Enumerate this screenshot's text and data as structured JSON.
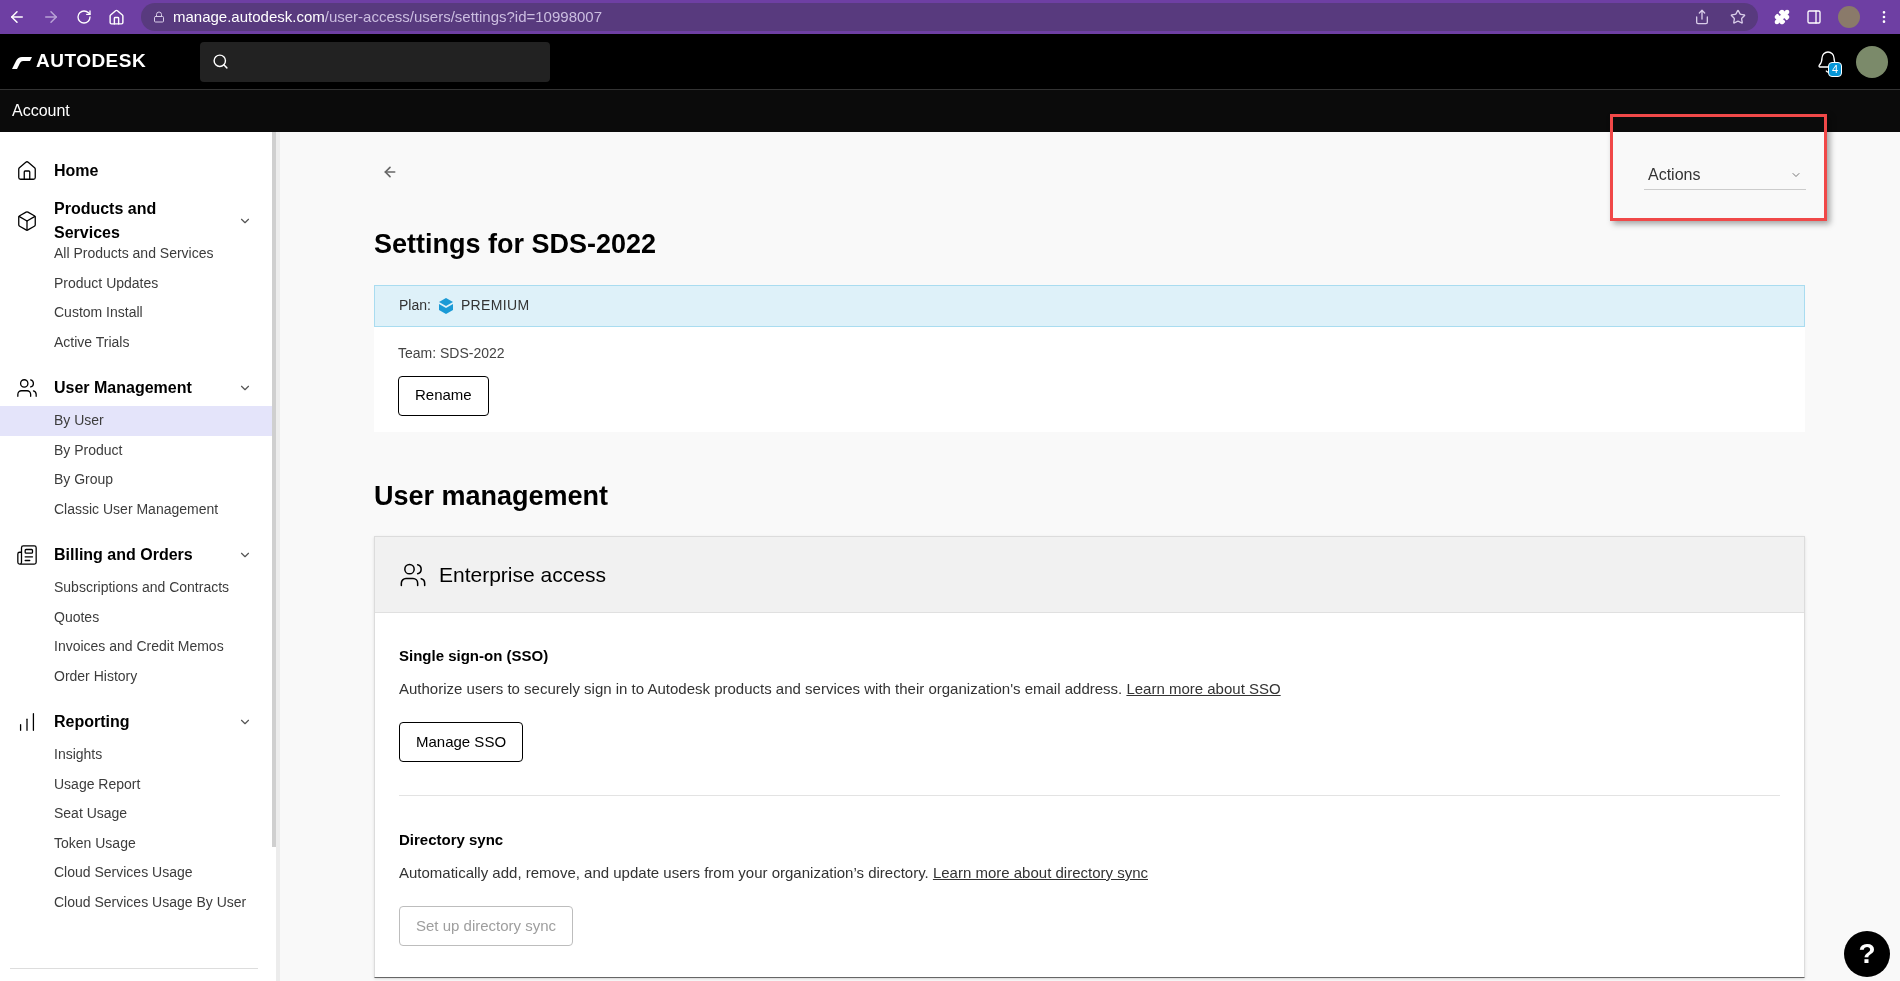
{
  "browser": {
    "url_host": "manage.autodesk.com",
    "url_path": "/user-access/users/settings?id=10998007",
    "forward_enabled": false
  },
  "header": {
    "logo": "AUTODESK",
    "notification_count": "4"
  },
  "account_bar": {
    "title": "Account"
  },
  "sidebar": {
    "home": {
      "label": "Home"
    },
    "sections": [
      {
        "label": "Products and Services",
        "expanded": true,
        "items": [
          {
            "label": "All Products and Services",
            "selected": false
          },
          {
            "label": "Product Updates",
            "selected": false
          },
          {
            "label": "Custom Install",
            "selected": false
          },
          {
            "label": "Active Trials",
            "selected": false
          }
        ]
      },
      {
        "label": "User Management",
        "expanded": true,
        "items": [
          {
            "label": "By User",
            "selected": true
          },
          {
            "label": "By Product",
            "selected": false
          },
          {
            "label": "By Group",
            "selected": false
          },
          {
            "label": "Classic User Management",
            "selected": false
          }
        ]
      },
      {
        "label": "Billing and Orders",
        "expanded": true,
        "items": [
          {
            "label": "Subscriptions and Contracts",
            "selected": false
          },
          {
            "label": "Quotes",
            "selected": false
          },
          {
            "label": "Invoices and Credit Memos",
            "selected": false
          },
          {
            "label": "Order History",
            "selected": false
          }
        ]
      },
      {
        "label": "Reporting",
        "expanded": true,
        "items": [
          {
            "label": "Insights",
            "selected": false
          },
          {
            "label": "Usage Report",
            "selected": false
          },
          {
            "label": "Seat Usage",
            "selected": false
          },
          {
            "label": "Token Usage",
            "selected": false
          },
          {
            "label": "Cloud Services Usage",
            "selected": false
          },
          {
            "label": "Cloud Services Usage By User",
            "selected": false
          }
        ]
      }
    ]
  },
  "actions": {
    "label": "Actions"
  },
  "title": "Settings for SDS-2022",
  "plan": {
    "label": "Plan:",
    "value": "PREMIUM"
  },
  "team": {
    "text": "Team: SDS-2022",
    "button": {
      "label": "Rename",
      "disabled": false
    }
  },
  "user_management": {
    "heading": "User management",
    "card_title": "Enterprise access",
    "sections": [
      {
        "title": "Single sign-on (SSO)",
        "description": "Authorize users to securely sign in to Autodesk products and services with their organization's email address.",
        "link": "Learn more about SSO",
        "button": {
          "label": "Manage SSO",
          "disabled": false
        }
      },
      {
        "title": "Directory sync",
        "description": "Automatically add, remove, and update users from your organization’s directory.",
        "link": "Learn more about directory sync",
        "button": {
          "label": "Set up directory sync",
          "disabled": true
        }
      }
    ]
  },
  "help": {
    "label": "?"
  }
}
